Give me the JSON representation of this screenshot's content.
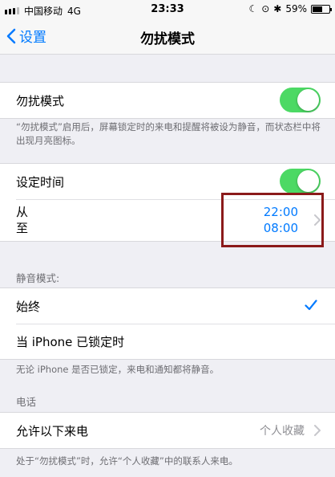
{
  "status_bar": {
    "carrier": "中国移动",
    "network": "4G",
    "time": "23:33",
    "battery_percent": "59%",
    "battery_level": 0.59
  },
  "nav": {
    "back_label": "设置",
    "title": "勿扰模式"
  },
  "dnd": {
    "label": "勿扰模式",
    "enabled": true,
    "description": "“勿扰模式”启用后，屏幕锁定时的来电和提醒将被设为静音，而状态栏中将出现月亮图标。"
  },
  "schedule": {
    "label": "设定时间",
    "enabled": true,
    "from_label": "从",
    "to_label": "至",
    "from_time": "22:00",
    "to_time": "08:00"
  },
  "silence": {
    "header": "静音模式:",
    "options": [
      {
        "label": "始终",
        "selected": true
      },
      {
        "label": "当 iPhone 已锁定时",
        "selected": false
      }
    ],
    "description": "无论 iPhone 是否已锁定，来电和通知都将静音。"
  },
  "phone": {
    "header": "电话",
    "allow_calls_label": "允许以下来电",
    "allow_calls_value": "个人收藏",
    "description": "处于“勿扰模式”时，允许“个人收藏”中的联系人来电。"
  },
  "colors": {
    "accent": "#007aff",
    "toggle_on": "#4cd964",
    "highlight": "#8b1a1a"
  }
}
